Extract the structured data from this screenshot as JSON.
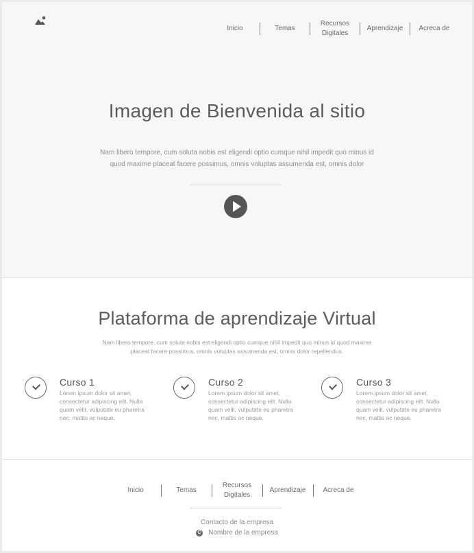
{
  "nav": {
    "items": [
      {
        "label": "Inicio"
      },
      {
        "label": "Temas"
      },
      {
        "label": "Recursos Digitales"
      },
      {
        "label": "Aprendizaje"
      },
      {
        "label": "Acreca de"
      }
    ]
  },
  "hero": {
    "title": "Imagen de Bienvenida al sitio",
    "text": "Nam libero tempore, cum soluta nobis est eligendi optio cumque nihil impedit quo minus id quod maxime placeat facere possimus, omnis voluptas assumenda est, omnis dolor"
  },
  "platform": {
    "title": "Plataforma de aprendizaje Virtual",
    "text": "Nam libero tempore, cum soluta nobis est eligendi optio cumque nihil impedit quo minus id quod maxime placeat facere possimus, omnis voluptas assumenda est, omnis dolor repellendus.",
    "courses": [
      {
        "title": "Curso 1",
        "text": "Lorem ipsum dolor sit amet, consectetur adipiscing elit. Nulla quam velit, vulputate eu pharetra nec, mattis ac neque."
      },
      {
        "title": "Curso 2",
        "text": "Lorem ipsum dolor sit amet, consectetur adipiscing elit. Nulla quam velit, vulputate eu pharetra nec, mattis ac neque."
      },
      {
        "title": "Curso 3",
        "text": "Lorem ipsum dolor sit amet, consectetur adipiscing elit. Nulla quam velit, vulputate eu pharetra nec, mattis ac neque."
      }
    ]
  },
  "footer": {
    "nav": [
      {
        "label": "Inicio"
      },
      {
        "label": "Temas"
      },
      {
        "label": "Recursos Digitales"
      },
      {
        "label": "Aprendizaje"
      },
      {
        "label": "Acreca de"
      }
    ],
    "contact": "Contacto de la empresa",
    "company": "Nombre de la empresa",
    "copyright_symbol": "C"
  },
  "icons": {
    "logo": "image-placeholder-icon",
    "play": "play-icon",
    "check": "check-icon",
    "copyright": "copyright-icon"
  },
  "colors": {
    "hero_background": "#f7f7f7",
    "play_button": "#555555",
    "text_primary": "#5c5c5c",
    "text_muted": "#9a9a9a"
  }
}
